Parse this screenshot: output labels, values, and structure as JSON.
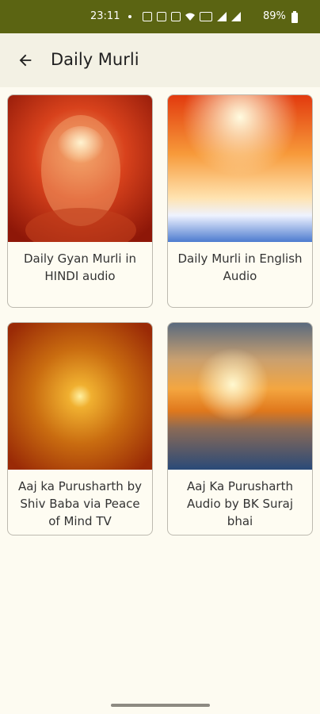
{
  "status_bar": {
    "time": "23:11",
    "battery": "89%"
  },
  "app_bar": {
    "title": "Daily Murli"
  },
  "cards": [
    {
      "label": "Daily Gyan Murli in HINDI audio"
    },
    {
      "label": "Daily Murli in English Audio"
    },
    {
      "label": "Aaj ka Purusharth by Shiv Baba via Peace of Mind TV"
    },
    {
      "label": "Aaj Ka Purusharth Audio by BK Suraj bhai"
    }
  ],
  "colors": {
    "status_bar": "#5b6412",
    "app_bar": "#f3f1e4",
    "background": "#fdfbf1",
    "card_border": "#bdbab0"
  }
}
